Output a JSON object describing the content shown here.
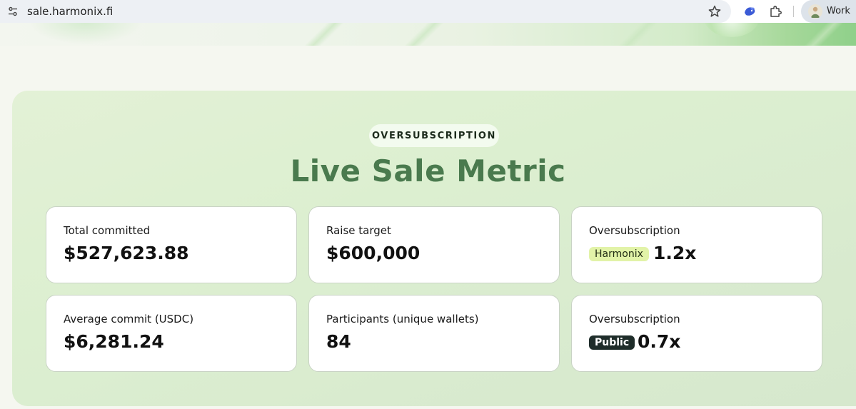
{
  "browser": {
    "url": "sale.harmonix.fi",
    "profile_label": "Work"
  },
  "section": {
    "tag": "OVERSUBSCRIPTION",
    "title": "Live Sale Metric"
  },
  "cards": {
    "total_committed": {
      "label": "Total committed",
      "value": "$527,623.88"
    },
    "raise_target": {
      "label": "Raise target",
      "value": "$600,000"
    },
    "oversub_harmonix": {
      "label": "Oversubscription",
      "badge": "Harmonix",
      "value": "1.2x"
    },
    "average_commit": {
      "label": "Average commit (USDC)",
      "value": "$6,281.24"
    },
    "participants": {
      "label": "Participants (unique wallets)",
      "value": "84"
    },
    "oversub_public": {
      "label": "Oversubscription",
      "badge": "Public",
      "value": "0.7x"
    }
  },
  "colors": {
    "heading": "#4a7a4e",
    "panel": "#dcefd0",
    "harmonix_badge": "#e2f3a8",
    "public_badge": "#1f2d2a"
  },
  "icons": {
    "site_info": "tune-icon",
    "bookmark": "star-icon",
    "extension": "bird-extension-icon",
    "extensions_menu": "puzzle-icon",
    "profile": "avatar"
  }
}
